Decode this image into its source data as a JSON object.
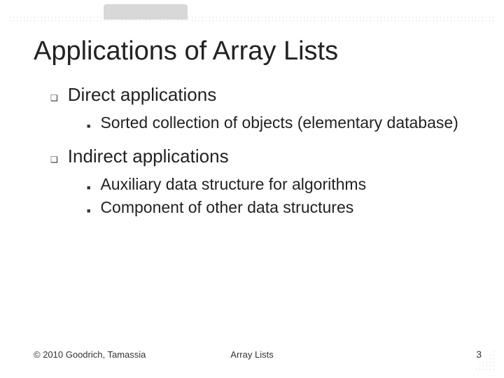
{
  "title": "Applications of Array Lists",
  "sections": [
    {
      "heading": "Direct applications",
      "items": [
        "Sorted collection of objects (elementary database)"
      ]
    },
    {
      "heading": "Indirect applications",
      "items": [
        "Auxiliary data structure for algorithms",
        "Component of other data structures"
      ]
    }
  ],
  "footer": {
    "left": "© 2010 Goodrich, Tamassia",
    "center": "Array Lists",
    "right": "3"
  }
}
